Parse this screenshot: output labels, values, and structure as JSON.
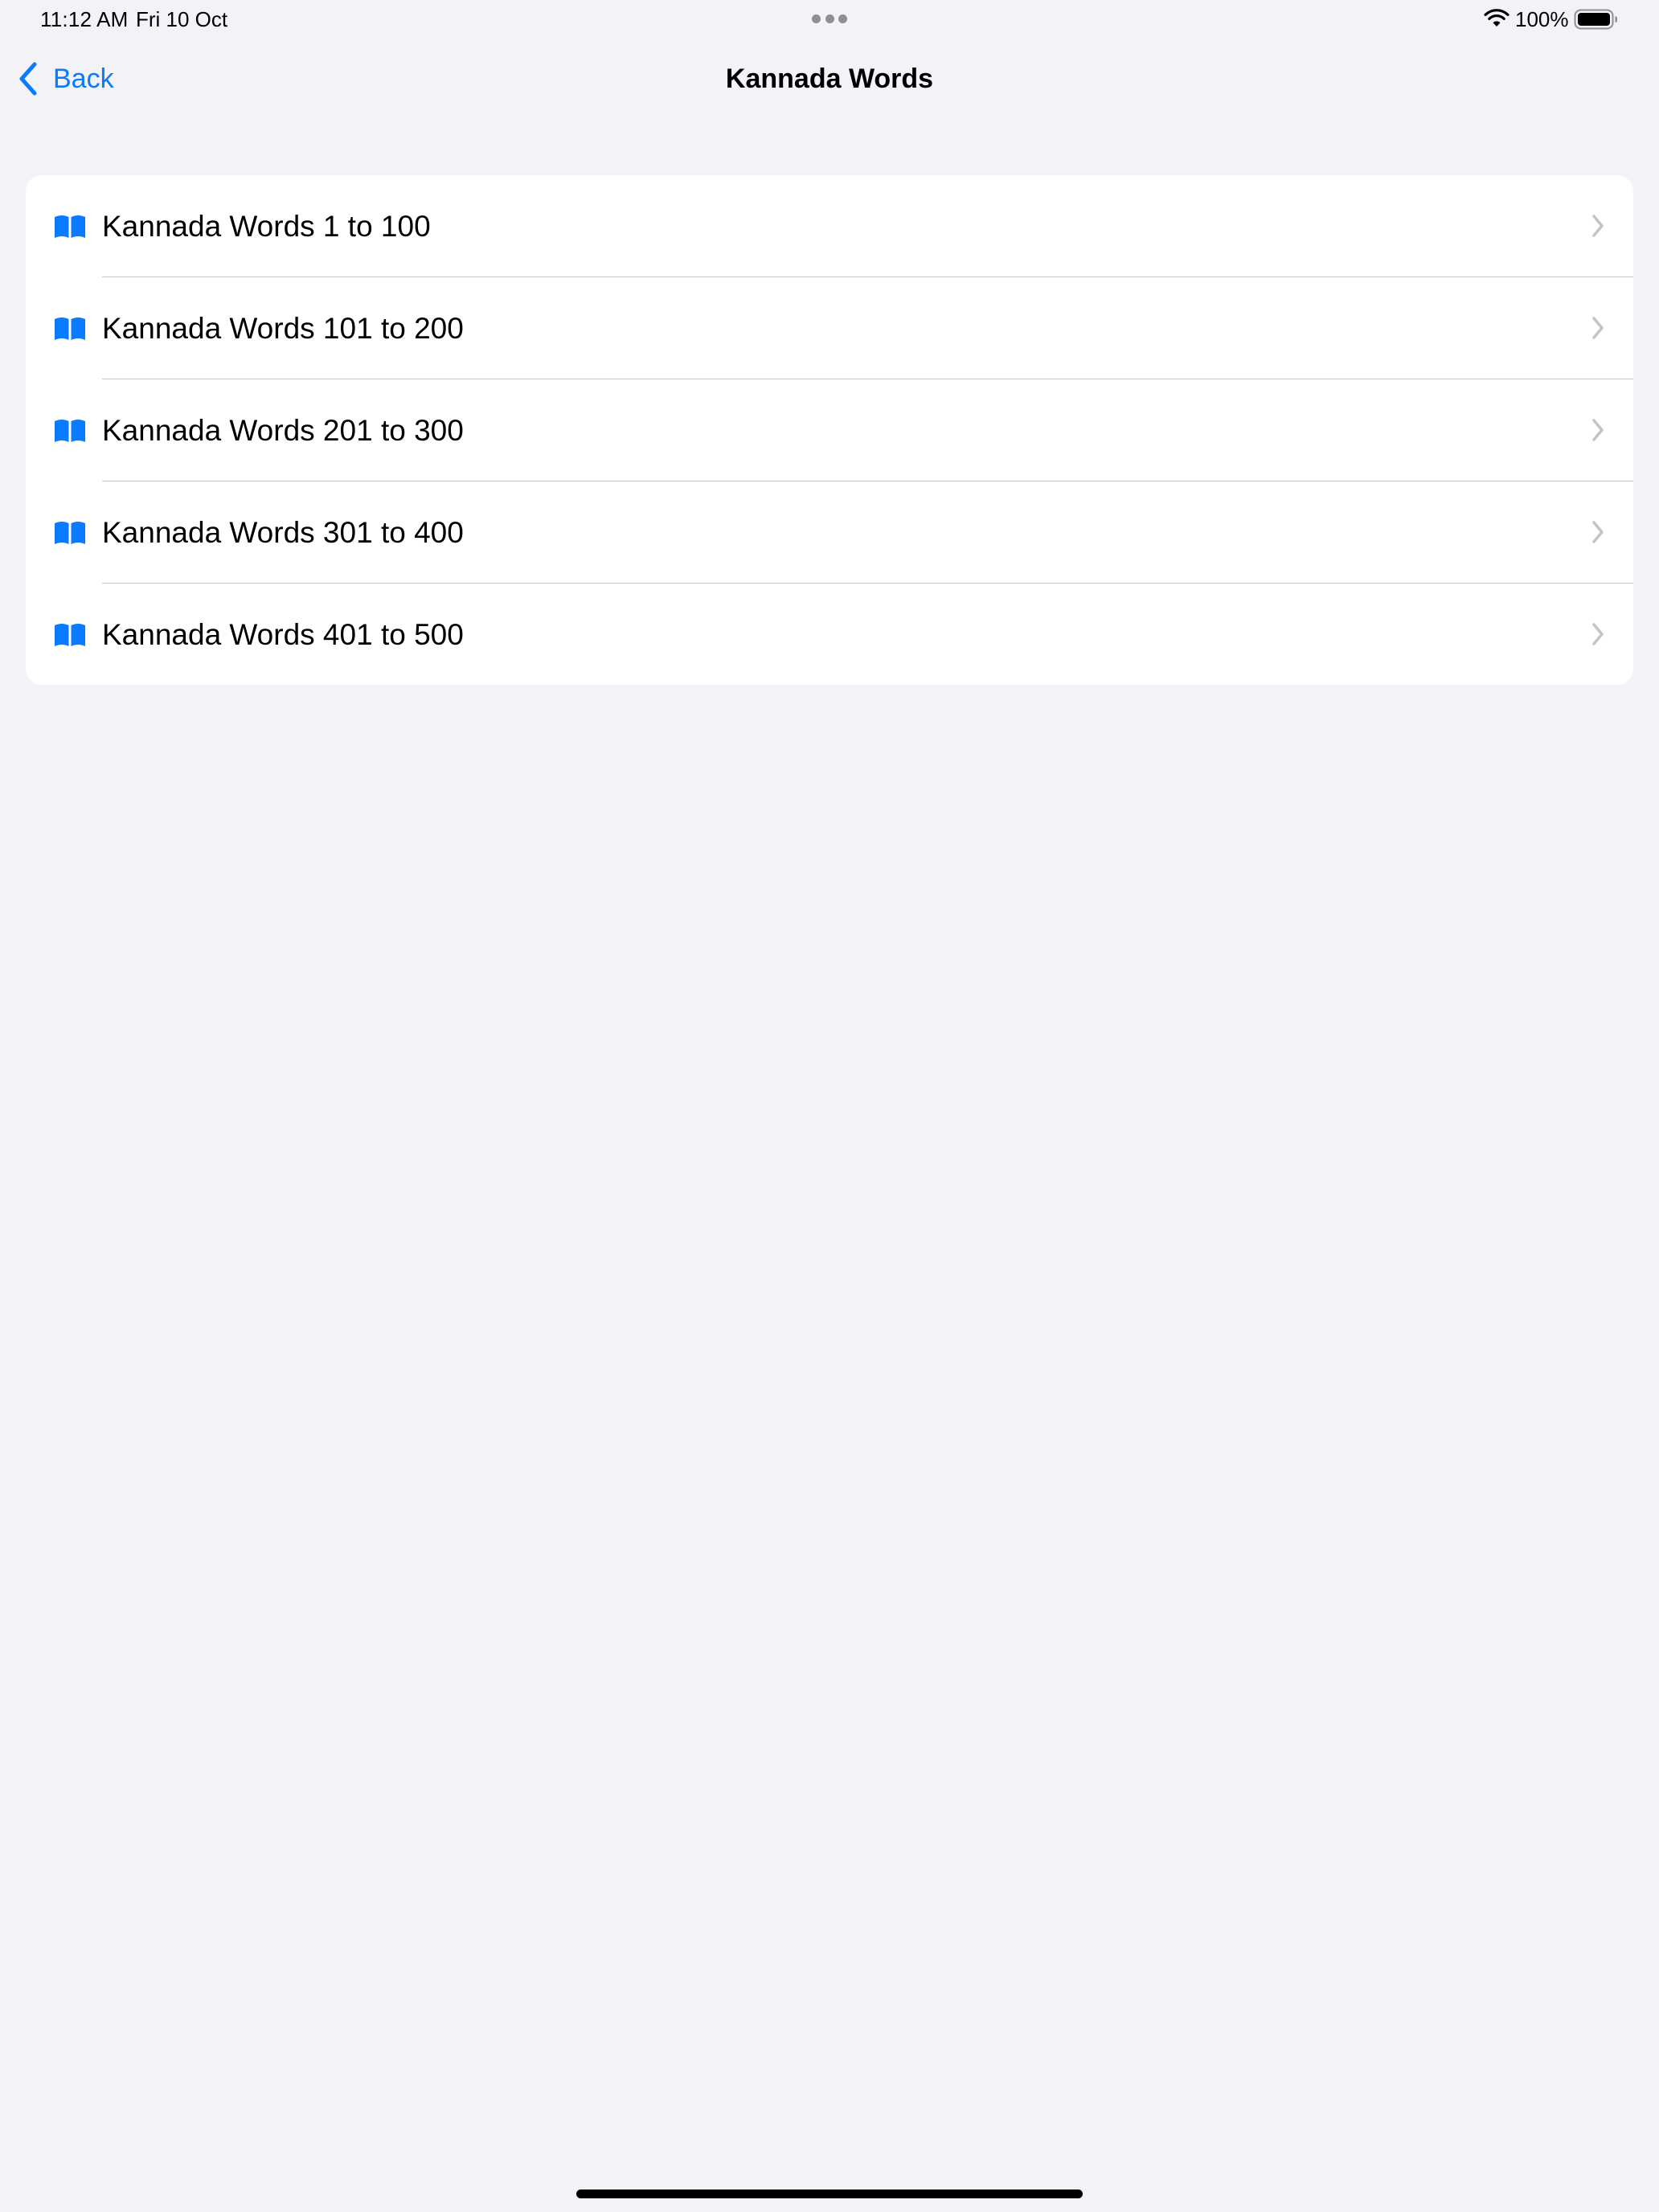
{
  "status_bar": {
    "time": "11:12 AM",
    "date": "Fri 10 Oct",
    "battery_percent": "100%",
    "battery_level": 1.0,
    "icons": [
      "multitasking-dots-icon",
      "wifi-icon",
      "battery-icon"
    ]
  },
  "nav": {
    "back_label": "Back",
    "back_icon": "chevron-left-icon",
    "title": "Kannada Words"
  },
  "list": {
    "items": [
      {
        "label": "Kannada Words 1 to 100",
        "icon": "book-icon"
      },
      {
        "label": "Kannada Words 101 to 200",
        "icon": "book-icon"
      },
      {
        "label": "Kannada Words 201 to 300",
        "icon": "book-icon"
      },
      {
        "label": "Kannada Words 301 to 400",
        "icon": "book-icon"
      },
      {
        "label": "Kannada Words 401 to 500",
        "icon": "book-icon"
      }
    ]
  },
  "colors": {
    "accent": "#0a7aff",
    "background": "#f2f2f7",
    "card": "#ffffff",
    "separator": "#c6c6c8",
    "chevron": "#c4c4c7"
  }
}
